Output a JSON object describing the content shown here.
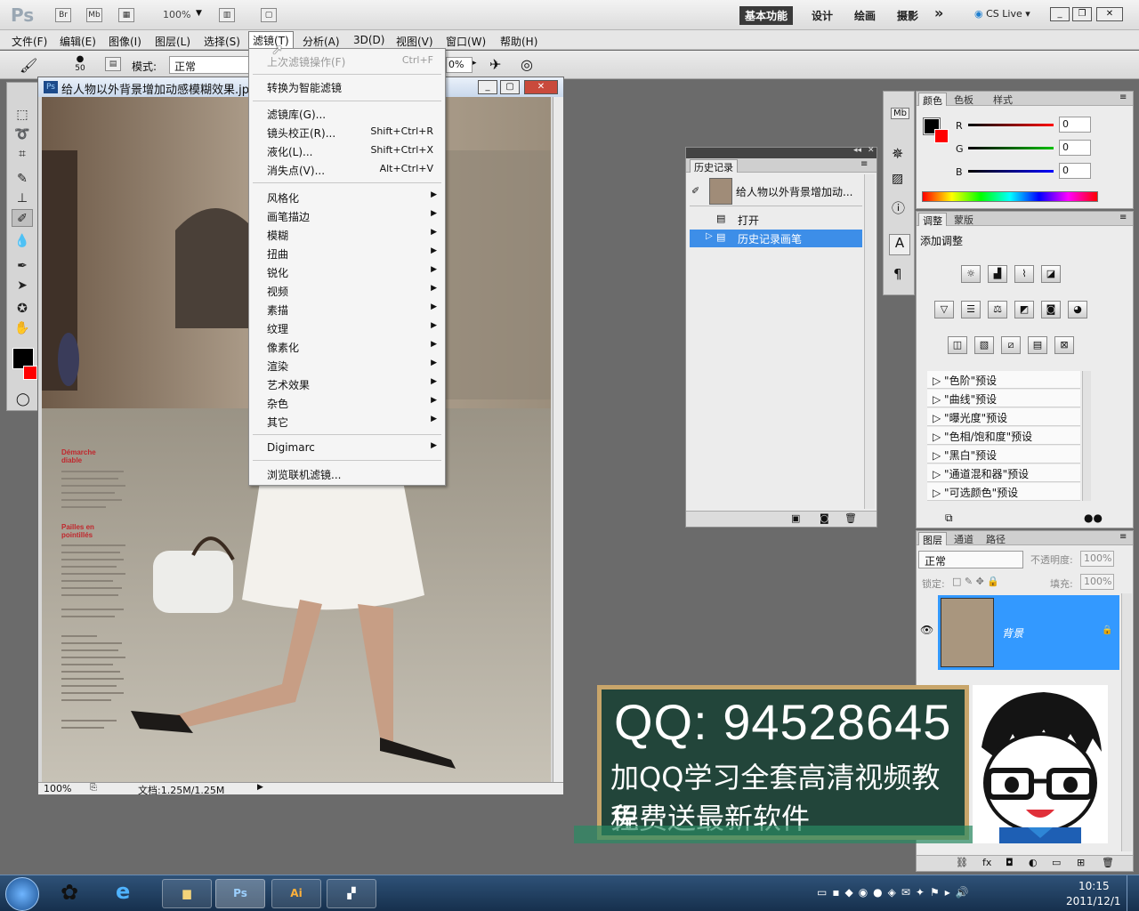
{
  "appbar": {
    "logo": "Ps",
    "bridge": "Br",
    "minibridge": "Mb",
    "zoom": "100%",
    "workspaces": [
      "基本功能",
      "设计",
      "绘画",
      "摄影"
    ],
    "more": "»",
    "cslive": "CS Live"
  },
  "menubar": {
    "items": [
      "文件(F)",
      "编辑(E)",
      "图像(I)",
      "图层(L)",
      "选择(S)",
      "滤镜(T)",
      "分析(A)",
      "3D(D)",
      "视图(V)",
      "窗口(W)",
      "帮助(H)"
    ]
  },
  "options": {
    "brush_size": "50",
    "mode_label": "模式:",
    "mode_value": "正常",
    "percent": "0%"
  },
  "filter_menu": {
    "last_filter": "上次滤镜操作(F)",
    "last_filter_shortcut": "Ctrl+F",
    "convert_smart": "转换为智能滤镜",
    "group2": [
      {
        "label": "滤镜库(G)...",
        "shortcut": ""
      },
      {
        "label": "镜头校正(R)...",
        "shortcut": "Shift+Ctrl+R"
      },
      {
        "label": "液化(L)...",
        "shortcut": "Shift+Ctrl+X"
      },
      {
        "label": "消失点(V)...",
        "shortcut": "Alt+Ctrl+V"
      }
    ],
    "submenus": [
      "风格化",
      "画笔描边",
      "模糊",
      "扭曲",
      "锐化",
      "视频",
      "素描",
      "纹理",
      "像素化",
      "渲染",
      "艺术效果",
      "杂色",
      "其它"
    ],
    "digimarc": "Digimarc",
    "browse": "浏览联机滤镜..."
  },
  "document": {
    "title": "给人物以外背景增加动感模糊效果.jpg",
    "zoom": "100%",
    "doc_info": "文档:1.25M/1.25M",
    "magazine_head1": "Démarche",
    "magazine_head1b": "diable",
    "magazine_head2": "Pailles en",
    "magazine_head2b": "pointillés"
  },
  "history": {
    "tab": "历史记录",
    "snapshot": "给人物以外背景增加动...",
    "items": [
      "打开",
      "历史记录画笔"
    ]
  },
  "color_panel": {
    "tabs": [
      "颜色",
      "色板",
      "样式"
    ],
    "channels": [
      {
        "name": "R",
        "value": "0",
        "color": "#d40000"
      },
      {
        "name": "G",
        "value": "0",
        "color": "#00a000"
      },
      {
        "name": "B",
        "value": "0",
        "color": "#0000c8"
      }
    ]
  },
  "adjust_panel": {
    "tabs": [
      "调整",
      "蒙版"
    ],
    "title": "添加调整",
    "presets": [
      "\"色阶\"预设",
      "\"曲线\"预设",
      "\"曝光度\"预设",
      "\"色相/饱和度\"预设",
      "\"黑白\"预设",
      "\"通道混和器\"预设",
      "\"可选颜色\"预设"
    ]
  },
  "layers_panel": {
    "tabs": [
      "图层",
      "通道",
      "路径"
    ],
    "blend": "正常",
    "opacity_label": "不透明度:",
    "opacity": "100%",
    "lock_label": "锁定:",
    "fill_label": "填充:",
    "fill": "100%",
    "layer_name": "背景"
  },
  "banner": {
    "qq": "QQ: 94528645",
    "line1": "加QQ学习全套高清视频教程",
    "line2": "免费送最新软件"
  },
  "taskbar": {
    "time": "10:15",
    "date": "2011/12/1",
    "apps": [
      "Ps",
      "Ai"
    ]
  },
  "colors": {
    "accent": "#3399ff",
    "selection": "#3d8ee8",
    "banner_bg": "#22453a",
    "banner_border": "#c8a56a"
  }
}
